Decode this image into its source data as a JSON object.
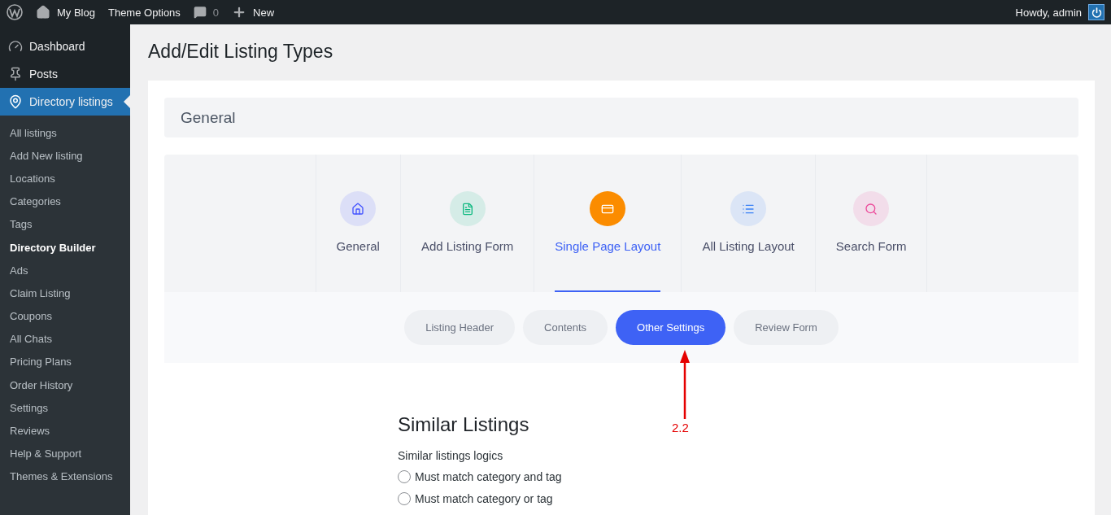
{
  "admin_bar": {
    "site_name": "My Blog",
    "theme_options": "Theme Options",
    "comments_count": "0",
    "new_label": "New",
    "greeting": "Howdy, admin"
  },
  "sidebar": {
    "items": [
      {
        "label": "Dashboard",
        "kind": "dashboard",
        "selected": false
      },
      {
        "label": "Posts",
        "kind": "posts",
        "selected": false
      },
      {
        "label": "Directory listings",
        "kind": "directory",
        "selected": true
      }
    ],
    "submenu": [
      {
        "label": "All listings",
        "selected": false
      },
      {
        "label": "Add New listing",
        "selected": false
      },
      {
        "label": "Locations",
        "selected": false
      },
      {
        "label": "Categories",
        "selected": false
      },
      {
        "label": "Tags",
        "selected": false
      },
      {
        "label": "Directory Builder",
        "selected": true
      },
      {
        "label": "Ads",
        "selected": false
      },
      {
        "label": "Claim Listing",
        "selected": false
      },
      {
        "label": "Coupons",
        "selected": false
      },
      {
        "label": "All Chats",
        "selected": false
      },
      {
        "label": "Pricing Plans",
        "selected": false
      },
      {
        "label": "Order History",
        "selected": false
      },
      {
        "label": "Settings",
        "selected": false
      },
      {
        "label": "Reviews",
        "selected": false
      },
      {
        "label": "Help & Support",
        "selected": false
      },
      {
        "label": "Themes & Extensions",
        "selected": false
      }
    ]
  },
  "page_title": "Add/Edit Listing Types",
  "section_header": "General",
  "tabs": [
    {
      "label": "General",
      "kind": "home",
      "color": "#4353ff",
      "selected": false
    },
    {
      "label": "Add Listing Form",
      "kind": "form",
      "color": "#10b981",
      "selected": false
    },
    {
      "label": "Single Page Layout",
      "kind": "card",
      "color": "#fb8c00",
      "selected": true
    },
    {
      "label": "All Listing Layout",
      "kind": "list",
      "color": "#3b82f6",
      "selected": false
    },
    {
      "label": "Search Form",
      "kind": "search",
      "color": "#ec4899",
      "selected": false
    }
  ],
  "subtabs": [
    {
      "label": "Listing Header",
      "selected": false
    },
    {
      "label": "Contents",
      "selected": false
    },
    {
      "label": "Other Settings",
      "selected": true
    },
    {
      "label": "Review Form",
      "selected": false
    }
  ],
  "annotation": {
    "label": "2.2"
  },
  "similar_listings": {
    "title": "Similar Listings",
    "field_label": "Similar listings logics",
    "options": [
      {
        "label": "Must match category and tag",
        "selected": false
      },
      {
        "label": "Must match category or tag",
        "selected": false
      }
    ]
  }
}
